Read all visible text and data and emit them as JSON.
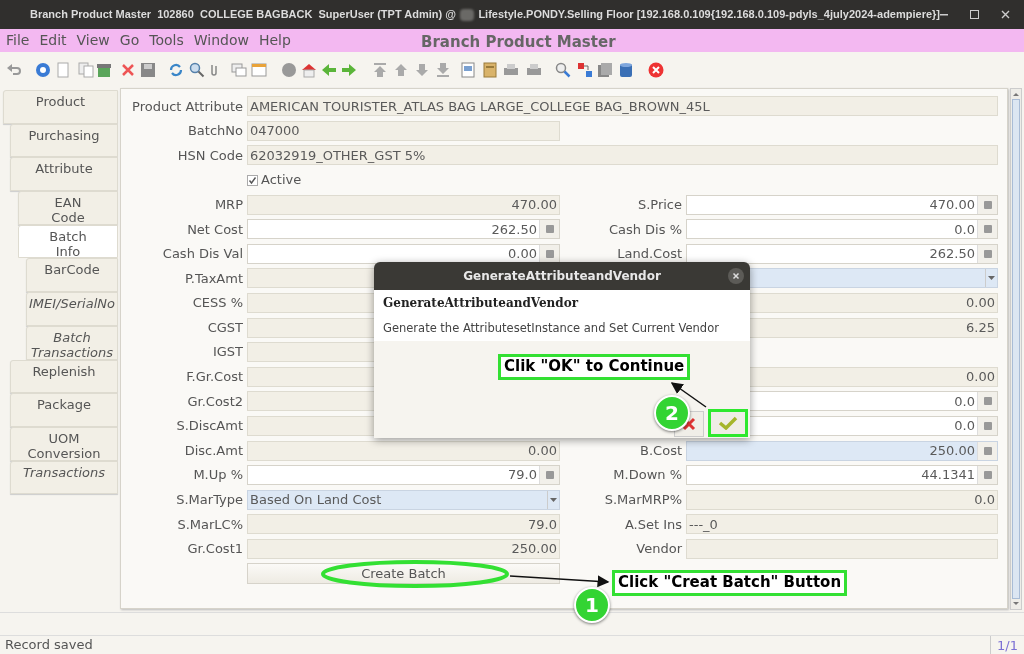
{
  "window": {
    "title_parts": [
      "Branch Product Master  102860  COLLEGE BAGBACK  SuperUser (TPT Admin) @",
      "Lifestyle.PONDY.Selling Floor [192.168.0.109{192.168.0.109-pdyls_4july2024-adempiere}]"
    ]
  },
  "menu": {
    "items": [
      "File",
      "Edit",
      "View",
      "Go",
      "Tools",
      "Window",
      "Help"
    ],
    "title": "Branch Product Master"
  },
  "tabs": [
    {
      "label": "Product",
      "selected": false,
      "italic": false,
      "children": [
        {
          "label": "Purchasing",
          "selected": false,
          "italic": false
        },
        {
          "label": "Attribute",
          "selected": false,
          "italic": false,
          "children": [
            {
              "label": "EAN\nCode",
              "selected": false,
              "italic": false
            },
            {
              "label": "Batch\nInfo",
              "selected": true,
              "italic": false,
              "children": [
                {
                  "label": "BarCode",
                  "selected": false,
                  "italic": false
                },
                {
                  "label": "IMEI/SerialNo",
                  "selected": false,
                  "italic": true
                },
                {
                  "label": "Batch\nTransactions",
                  "selected": false,
                  "italic": true
                }
              ]
            }
          ]
        },
        {
          "label": "Replenish",
          "selected": false,
          "italic": false
        },
        {
          "label": "Package",
          "selected": false,
          "italic": false
        },
        {
          "label": "UOM\nConversion",
          "selected": false,
          "italic": false
        },
        {
          "label": "Transactions",
          "selected": false,
          "italic": true
        }
      ]
    }
  ],
  "form": {
    "header_fields": [
      {
        "label": "Product Attribute",
        "value": "AMERICAN TOURISTER_ATLAS BAG LARGE_COLLEGE BAG_BROWN_45L",
        "kind": "wide_text"
      },
      {
        "label": "BatchNo",
        "value": "047000",
        "kind": "display_text"
      },
      {
        "label": "HSN Code",
        "value": "62032919_OTHER_GST 5%",
        "kind": "wide_text"
      }
    ],
    "active": {
      "label": "Active",
      "checked": true
    },
    "rows": [
      {
        "left": {
          "label": "MRP",
          "value": "470.00",
          "kind": "display"
        },
        "right": {
          "label": "S.Price",
          "value": "470.00",
          "kind": "number"
        }
      },
      {
        "left": {
          "label": "Net Cost",
          "value": "262.50",
          "kind": "number"
        },
        "right": {
          "label": "Cash Dis %",
          "value": "0.0",
          "kind": "number"
        }
      },
      {
        "left": {
          "label": "Cash Dis Val",
          "value": "0.00",
          "kind": "number"
        },
        "right": {
          "label": "Land.Cost",
          "value": "262.50",
          "kind": "number"
        }
      },
      {
        "left": {
          "label": "P.TaxAmt",
          "kind": "display"
        },
        "right": {
          "kind": "dropdown"
        }
      },
      {
        "left": {
          "label": "CESS %",
          "kind": "display"
        },
        "right": {
          "value": "0.00",
          "kind": "display"
        }
      },
      {
        "left": {
          "label": "CGST",
          "kind": "display"
        },
        "right": {
          "value": "6.25",
          "kind": "display"
        }
      },
      {
        "left": {
          "label": "IGST",
          "kind": "display"
        }
      },
      {
        "left": {
          "label": "F.Gr.Cost",
          "kind": "display"
        },
        "right": {
          "value": "0.00",
          "kind": "display"
        }
      },
      {
        "left": {
          "label": "Gr.Cost2",
          "kind": "display"
        },
        "right": {
          "value": "0.0",
          "kind": "number"
        }
      },
      {
        "left": {
          "label": "S.DiscAmt",
          "kind": "display"
        },
        "right": {
          "value": "0.0",
          "kind": "number"
        }
      },
      {
        "left": {
          "label": "Disc.Amt",
          "value": "0.00",
          "kind": "display"
        },
        "right": {
          "label": "B.Cost",
          "value": "250.00",
          "kind": "highlight"
        }
      },
      {
        "left": {
          "label": "M.Up %",
          "value": "79.0",
          "kind": "number"
        },
        "right": {
          "label": "M.Down %",
          "value": "44.1341",
          "kind": "number"
        }
      },
      {
        "left": {
          "label": "S.MarType",
          "value": "Based On Land Cost",
          "kind": "dropdown"
        },
        "right": {
          "label": "S.MarMRP%",
          "value": "0.0",
          "kind": "display"
        }
      },
      {
        "left": {
          "label": "S.MarLC%",
          "value": "79.0",
          "kind": "display"
        },
        "right": {
          "label": "A.Set Ins",
          "value": "---_0",
          "kind": "display_text"
        }
      },
      {
        "left": {
          "label": "Gr.Cost1",
          "value": "250.00",
          "kind": "display"
        },
        "right": {
          "label": "Vendor",
          "kind": "display_text"
        }
      }
    ],
    "create_button": "Create Batch"
  },
  "dialog": {
    "title": "GenerateAttributeandVendor",
    "heading": "GenerateAttributeandVendor",
    "description": "Generate the AttributesetInstance and Set Current Vendor"
  },
  "annotations": [
    {
      "kind": "callout",
      "text": "Clik \"OK\" to Continue"
    },
    {
      "kind": "step",
      "text": "2"
    },
    {
      "kind": "callout",
      "text": "Click \"Creat Batch\" Button"
    },
    {
      "kind": "step",
      "text": "1"
    }
  ],
  "status_bar": {
    "message": "Record saved",
    "record_count": "1/1"
  }
}
